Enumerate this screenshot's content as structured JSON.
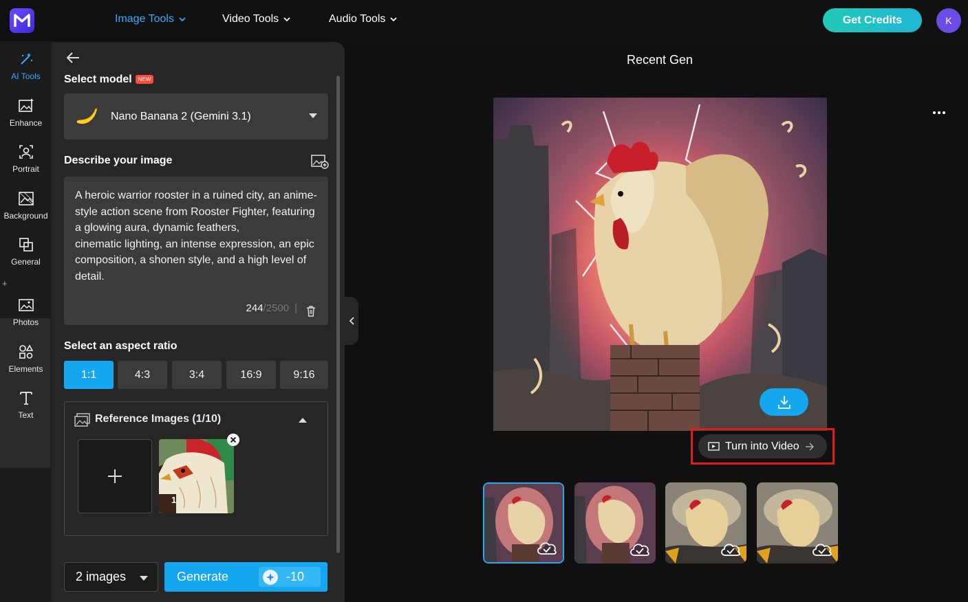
{
  "nav": {
    "items": [
      {
        "label": "Image Tools",
        "active": true
      },
      {
        "label": "Video Tools",
        "active": false
      },
      {
        "label": "Audio Tools",
        "active": false
      }
    ],
    "credits_label": "Get Credits",
    "avatar_initial": "K"
  },
  "rail": {
    "items": [
      "AI Tools",
      "Enhance",
      "Portrait",
      "Background",
      "General",
      "Photos",
      "Elements",
      "Text"
    ]
  },
  "panel": {
    "select_model_label": "Select model",
    "new_badge": "NEW",
    "model_name": "Nano Banana 2 (Gemini 3.1)",
    "describe_label": "Describe your image",
    "prompt_text": "A heroic warrior rooster in a ruined city, an anime-style action scene from Rooster Fighter, featuring a glowing aura, dynamic feathers,\ncinematic lighting, an intense expression, an epic composition, a shonen style, and a high level of detail.",
    "char_count": "244",
    "char_max": "/2500",
    "char_sep": "|",
    "aspect_label": "Select an aspect ratio",
    "aspect_ratios": [
      "1:1",
      "4:3",
      "3:4",
      "16:9",
      "9:16"
    ],
    "selected_ratio": "1:1",
    "reference_label": "Reference Images (1/10)",
    "reference_count_badge": "1",
    "image_count": "2 images",
    "generate_label": "Generate",
    "generate_cost": "-10"
  },
  "main": {
    "title": "Recent Gen",
    "turn_into_video": "Turn into Video",
    "thumbnails": 4
  },
  "colors": {
    "accent": "#14a7f0",
    "highlight": "#e01b1b",
    "credits": "#22c9b6"
  }
}
